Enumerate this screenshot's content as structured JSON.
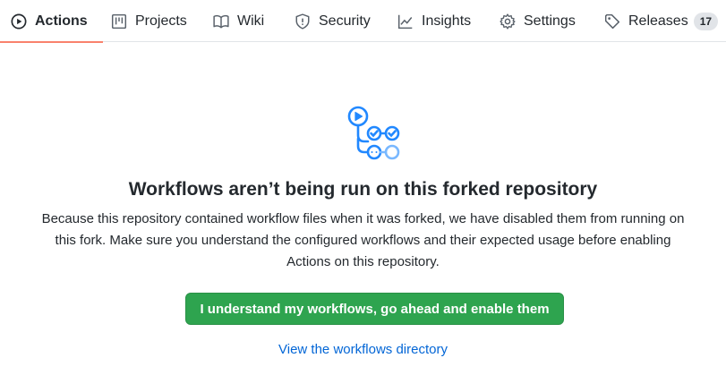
{
  "tabs": [
    {
      "label": "Actions",
      "icon": "play-icon",
      "selected": true
    },
    {
      "label": "Projects",
      "icon": "project-icon"
    },
    {
      "label": "Wiki",
      "icon": "book-icon"
    },
    {
      "label": "Security",
      "icon": "shield-icon"
    },
    {
      "label": "Insights",
      "icon": "graph-icon"
    },
    {
      "label": "Settings",
      "icon": "gear-icon"
    },
    {
      "label": "Releases",
      "icon": "tag-icon",
      "count": "17"
    }
  ],
  "main": {
    "icon": "workflow-icon",
    "title": "Workflows aren’t being run on this forked repository",
    "description": "Because this repository contained workflow files when it was forked, we have disabled them from running on this fork. Make sure you understand the configured workflows and their expected usage before enabling Actions on this repository.",
    "enable_button": "I understand my workflows, go ahead and enable them",
    "directory_link": "View the workflows directory"
  },
  "colors": {
    "accent_underline": "#f9826c",
    "button_green": "#2ea44f",
    "link_blue": "#0366d6",
    "icon_blue": "#2188ff"
  }
}
